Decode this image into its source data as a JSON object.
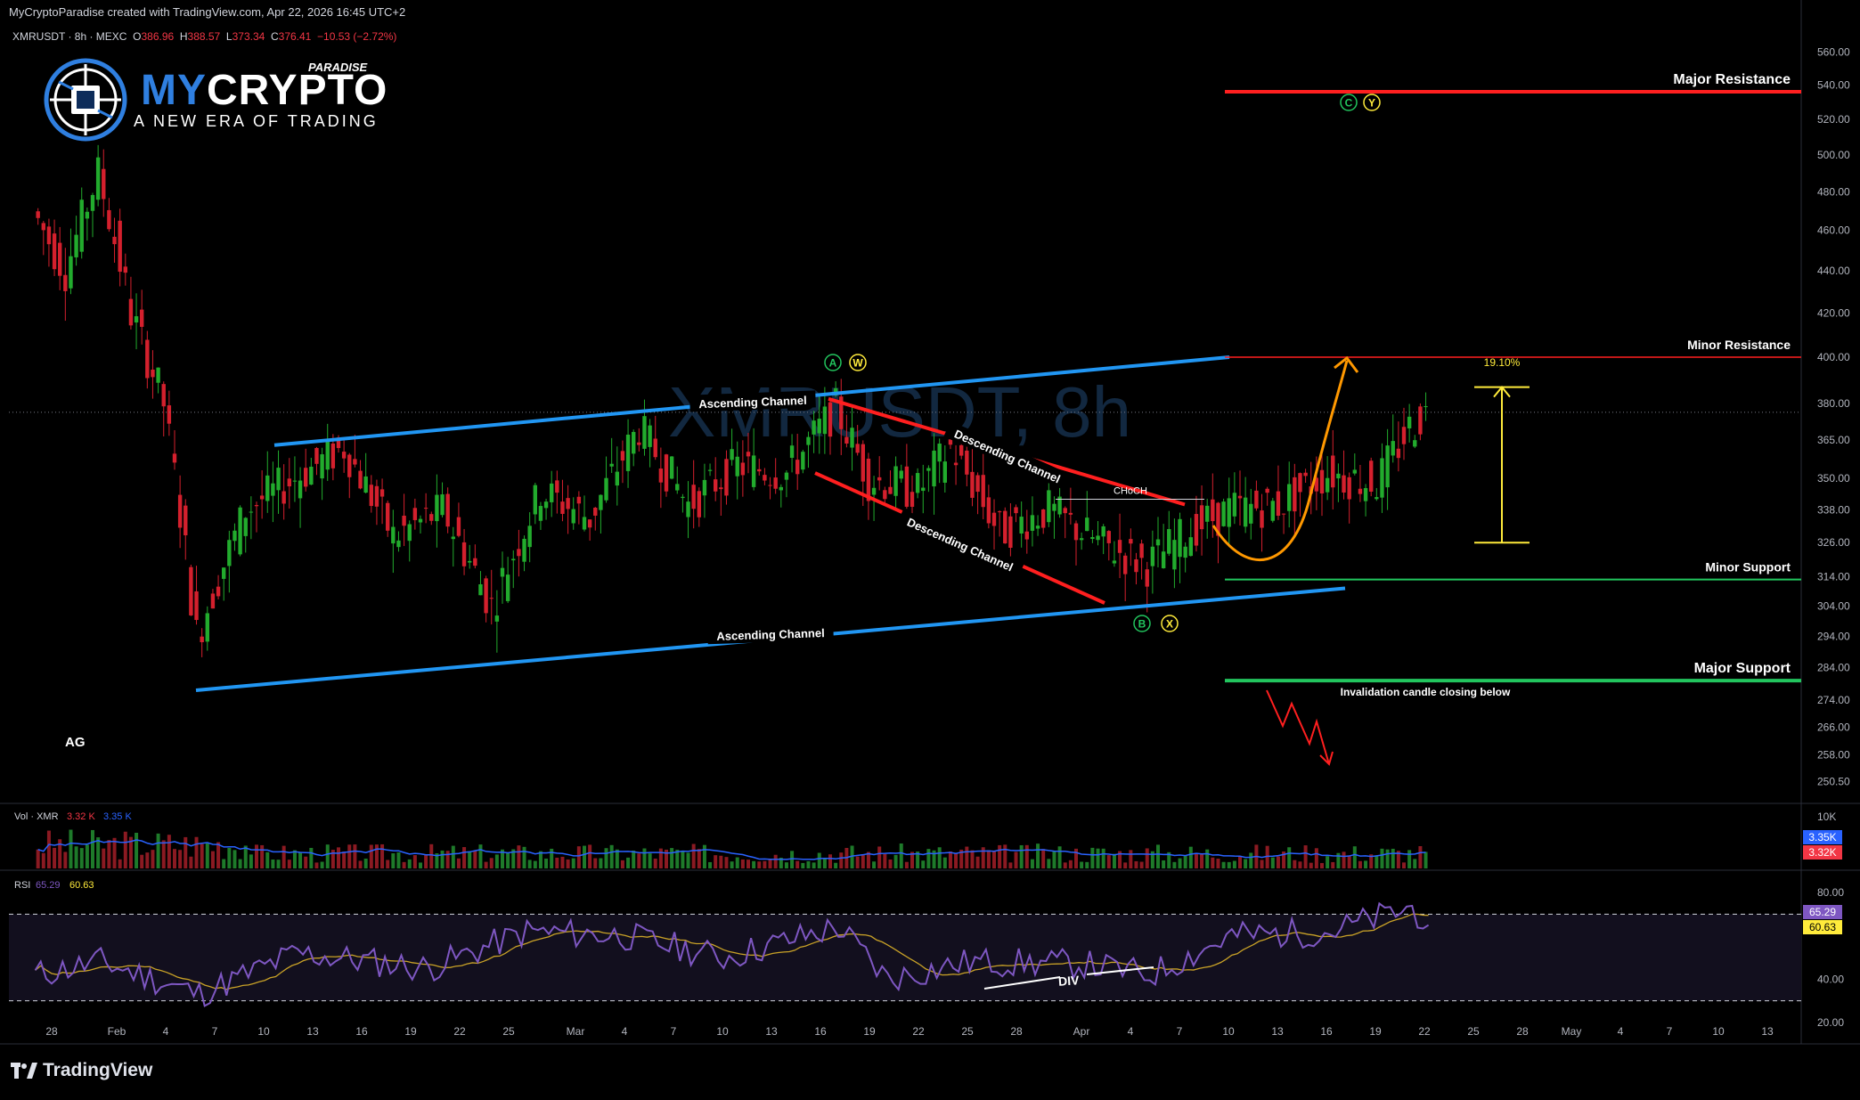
{
  "header": {
    "attribution": "MyCryptoParadise created with TradingView.com, Apr 22, 2026 16:45 UTC+2"
  },
  "legend": {
    "symbol": "XMRUSDT · 8h · MEXC",
    "open_label": "O",
    "open": "386.96",
    "high_label": "H",
    "high": "388.57",
    "low_label": "L",
    "low": "373.34",
    "close_label": "C",
    "close": "376.41",
    "change": "−10.53 (−2.72%)"
  },
  "watermark": "XMRUSDT, 8h",
  "logo": {
    "brand_a": "MY",
    "brand_b": "CRYPTO",
    "superscript": "PARADISE",
    "tagline": "A NEW ERA OF TRADING",
    "icon": "globe-chip-icon"
  },
  "corner_label": "AG",
  "annotations": {
    "major_resistance": "Major Resistance",
    "minor_resistance": "Minor Resistance",
    "minor_support": "Minor Support",
    "major_support": "Major Support",
    "invalidation": "Invalidation candle closing below",
    "ascending_upper": "Ascending Channel",
    "ascending_lower": "Ascending Channel",
    "descending_upper": "Descending Channel",
    "descending_lower": "Descending Channel",
    "choch": "CHoCH",
    "target_pct": "19.10%",
    "div": "DIV",
    "wave_a": "A",
    "wave_w": "W",
    "wave_b": "B",
    "wave_x": "X",
    "wave_c": "C",
    "wave_y": "Y"
  },
  "price_axis": {
    "ticks": [
      "560.00",
      "540.00",
      "520.00",
      "500.00",
      "480.00",
      "460.00",
      "440.00",
      "420.00",
      "400.00",
      "380.00",
      "365.00",
      "350.00",
      "338.00",
      "326.00",
      "314.00",
      "304.00",
      "294.00",
      "284.00",
      "274.00",
      "266.00",
      "258.00",
      "250.50"
    ]
  },
  "volume_pane": {
    "label": "Vol · XMR",
    "v1": "3.32 K",
    "v2": "3.35 K",
    "axis_top": "10K",
    "badge_ma": "3.35K",
    "badge_vol": "3.32K"
  },
  "rsi_pane": {
    "label": "RSI",
    "rsi": "65.29",
    "rsi_ma": "60.63",
    "ticks": [
      "80.00",
      "40.00",
      "20.00"
    ],
    "badge_rsi": "65.29",
    "badge_ma": "60.63"
  },
  "time_axis": {
    "labels": [
      "28",
      "Feb",
      "4",
      "7",
      "10",
      "13",
      "16",
      "19",
      "22",
      "25",
      "Mar",
      "4",
      "7",
      "10",
      "13",
      "16",
      "19",
      "22",
      "25",
      "28",
      "Apr",
      "4",
      "7",
      "10",
      "13",
      "16",
      "19",
      "22",
      "25",
      "28",
      "May",
      "4",
      "7",
      "10",
      "13"
    ]
  },
  "footer": {
    "brand": "TradingView",
    "icon": "tradingview-logo-icon"
  },
  "chart_data": {
    "type": "candlestick",
    "symbol": "XMRUSDT",
    "timeframe": "8h",
    "exchange": "MEXC",
    "y_range": [
      245,
      568
    ],
    "log_scale": true,
    "levels": {
      "major_resistance": 536,
      "minor_resistance": 400,
      "minor_support": 313,
      "major_support": 280,
      "choch": 342,
      "measure_start": 326,
      "measure_end": 387
    },
    "keypoints": [
      {
        "date": "Jan 27",
        "price": 470
      },
      {
        "date": "Jan 29",
        "price": 440
      },
      {
        "date": "Jan 31",
        "price": 490
      },
      {
        "date": "Feb 2",
        "price": 420
      },
      {
        "date": "Feb 4",
        "price": 380
      },
      {
        "date": "Feb 6",
        "price": 294
      },
      {
        "date": "Feb 9",
        "price": 338
      },
      {
        "date": "Feb 12",
        "price": 350
      },
      {
        "date": "Feb 15",
        "price": 362
      },
      {
        "date": "Feb 18",
        "price": 328
      },
      {
        "date": "Feb 21",
        "price": 338
      },
      {
        "date": "Feb 24",
        "price": 304
      },
      {
        "date": "Feb 27",
        "price": 345
      },
      {
        "date": "Mar 2",
        "price": 335
      },
      {
        "date": "Mar 5",
        "price": 370
      },
      {
        "date": "Mar 8",
        "price": 340
      },
      {
        "date": "Mar 11",
        "price": 355
      },
      {
        "date": "Mar 14",
        "price": 352
      },
      {
        "date": "Mar 17",
        "price": 378
      },
      {
        "date": "Mar 19",
        "price": 350
      },
      {
        "date": "Mar 22",
        "price": 345
      },
      {
        "date": "Mar 24",
        "price": 362
      },
      {
        "date": "Mar 27",
        "price": 330
      },
      {
        "date": "Mar 30",
        "price": 338
      },
      {
        "date": "Apr 2",
        "price": 326
      },
      {
        "date": "Apr 5",
        "price": 318
      },
      {
        "date": "Apr 8",
        "price": 332
      },
      {
        "date": "Apr 10",
        "price": 338
      },
      {
        "date": "Apr 13",
        "price": 340
      },
      {
        "date": "Apr 16",
        "price": 352
      },
      {
        "date": "Apr 19",
        "price": 348
      },
      {
        "date": "Apr 21",
        "price": 370
      },
      {
        "date": "Apr 22",
        "price": 376
      }
    ],
    "rsi_keypoints": [
      {
        "date": "Jan 27",
        "value": 42
      },
      {
        "date": "Jan 31",
        "value": 48
      },
      {
        "date": "Feb 6",
        "value": 33
      },
      {
        "date": "Feb 12",
        "value": 52
      },
      {
        "date": "Feb 20",
        "value": 45
      },
      {
        "date": "Feb 26",
        "value": 62
      },
      {
        "date": "Mar 4",
        "value": 60
      },
      {
        "date": "Mar 10",
        "value": 50
      },
      {
        "date": "Mar 17",
        "value": 64
      },
      {
        "date": "Mar 20",
        "value": 40
      },
      {
        "date": "Mar 25",
        "value": 48
      },
      {
        "date": "Apr 1",
        "value": 47
      },
      {
        "date": "Apr 5",
        "value": 42
      },
      {
        "date": "Apr 10",
        "value": 60
      },
      {
        "date": "Apr 16",
        "value": 62
      },
      {
        "date": "Apr 21",
        "value": 73
      },
      {
        "date": "Apr 22",
        "value": 65
      }
    ]
  }
}
